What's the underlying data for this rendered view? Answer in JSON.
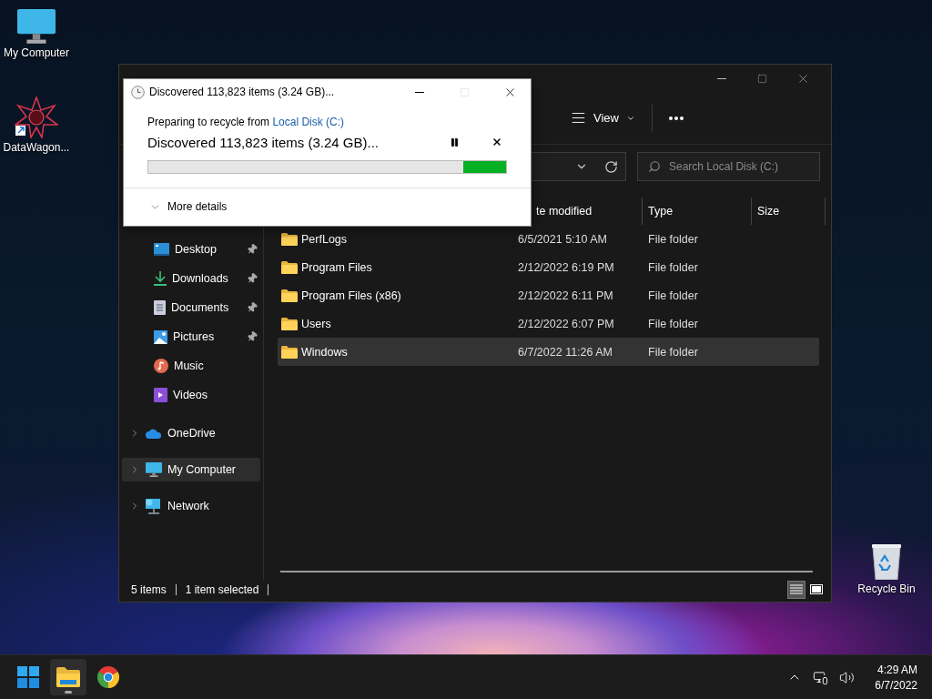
{
  "desktop_icons": [
    {
      "kind": "computer",
      "label": "My Computer"
    },
    {
      "kind": "shortcut",
      "label": "DataWagon..."
    }
  ],
  "recycle_bin": {
    "label": "Recycle Bin"
  },
  "explorer": {
    "toolbar": {
      "view_label": "View"
    },
    "search": {
      "placeholder": "Search Local Disk (C:)"
    },
    "columns": [
      "te modified",
      "Type",
      "Size"
    ],
    "sidebar": {
      "quick_access": [
        {
          "kind": "desktop",
          "label": "Desktop",
          "pinned": true
        },
        {
          "kind": "downloads",
          "label": "Downloads",
          "pinned": true
        },
        {
          "kind": "documents",
          "label": "Documents",
          "pinned": true
        },
        {
          "kind": "pictures",
          "label": "Pictures",
          "pinned": true
        },
        {
          "kind": "music",
          "label": "Music",
          "pinned": false
        },
        {
          "kind": "videos",
          "label": "Videos",
          "pinned": false
        }
      ],
      "locations": [
        {
          "kind": "cloud",
          "label": "OneDrive",
          "selected": false
        },
        {
          "kind": "computer",
          "label": "My Computer",
          "selected": true
        },
        {
          "kind": "network",
          "label": "Network",
          "selected": false
        }
      ]
    },
    "rows": [
      {
        "name": "PerfLogs",
        "date": "6/5/2021 5:10 AM",
        "type": "File folder",
        "selected": false
      },
      {
        "name": "Program Files",
        "date": "2/12/2022 6:19 PM",
        "type": "File folder",
        "selected": false
      },
      {
        "name": "Program Files (x86)",
        "date": "2/12/2022 6:11 PM",
        "type": "File folder",
        "selected": false
      },
      {
        "name": "Users",
        "date": "2/12/2022 6:07 PM",
        "type": "File folder",
        "selected": false
      },
      {
        "name": "Windows",
        "date": "6/7/2022 11:26 AM",
        "type": "File folder",
        "selected": true
      }
    ],
    "status_bar": {
      "count": "5 items",
      "selection": "1 item selected",
      "views": [
        {
          "kind": "details",
          "selected": true
        },
        {
          "kind": "tiles",
          "selected": false
        }
      ]
    }
  },
  "dialog": {
    "title": "Discovered 113,823 items (3.24 GB)...",
    "maximize_disabled": true,
    "subtitle": "Preparing to recycle from ",
    "source_link": "Local Disk (C:)",
    "heading": "Discovered 113,823 items (3.24 GB)...",
    "progress": {
      "kind": "marquee",
      "level": 0.12
    },
    "details_label": "More details"
  },
  "taskbar": {
    "apps": [
      {
        "kind": "start",
        "active": false
      },
      {
        "kind": "explorer",
        "active": true
      },
      {
        "kind": "chrome",
        "active": false
      }
    ],
    "time": "4:29 AM",
    "date": "6/7/2022"
  }
}
